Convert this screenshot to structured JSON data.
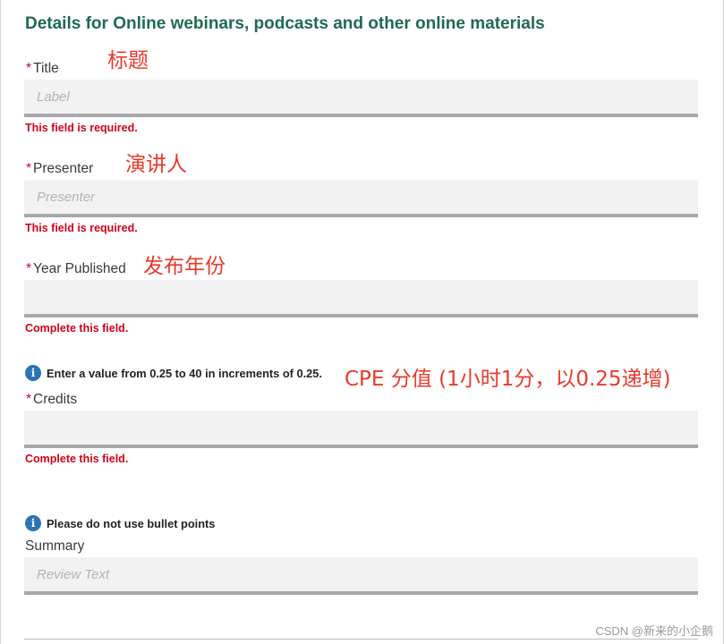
{
  "form": {
    "heading": "Details for Online webinars, podcasts and other online materials",
    "required_marker": "*",
    "title": {
      "label": "Title",
      "placeholder": "Label",
      "value": "",
      "error": "This field is required."
    },
    "presenter": {
      "label": "Presenter",
      "placeholder": "Presenter",
      "value": "",
      "error": "This field is required."
    },
    "year_published": {
      "label": "Year Published",
      "placeholder": "",
      "value": "",
      "error": "Complete this field."
    },
    "credits": {
      "info_icon": "info-icon",
      "info_text": "Enter a value from 0.25 to 40 in increments of 0.25.",
      "label": "Credits",
      "placeholder": "",
      "value": "",
      "error": "Complete this field."
    },
    "summary": {
      "info_icon": "info-icon",
      "info_text": "Please do not use bullet points",
      "label": "Summary",
      "placeholder": "Review Text",
      "value": ""
    }
  },
  "annotations": {
    "title": "标题",
    "presenter": "演讲人",
    "year_published": "发布年份",
    "credits": "CPE 分值 (1小时1分，以0.25递增)"
  },
  "watermark": "CSDN @新来的小企鹅",
  "colors": {
    "heading": "#1f6b4d",
    "error": "#d0021b",
    "info_icon": "#2b74b5",
    "annotation": "#e83a2b",
    "field_background": "#f2f2f2",
    "field_underline": "#a8a8a8"
  }
}
